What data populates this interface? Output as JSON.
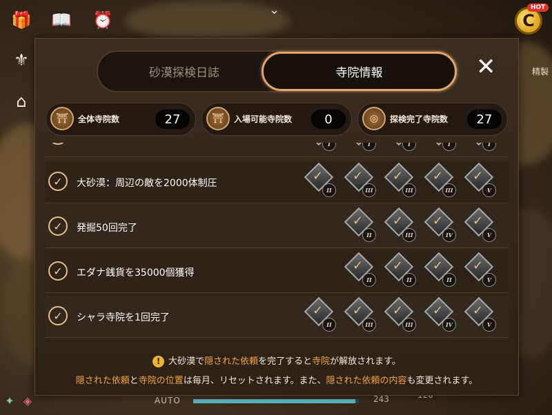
{
  "colors": {
    "accent": "#e2a56a",
    "highlight": "#f5a23a",
    "panel": "#33281d"
  },
  "tabs": [
    {
      "label": "砂漠探検日誌",
      "active": false
    },
    {
      "label": "寺院情報",
      "active": true
    }
  ],
  "stats": [
    {
      "label": "全体寺院数",
      "value": "27"
    },
    {
      "label": "入場可能寺院数",
      "value": "0"
    },
    {
      "label": "探検完了寺院数",
      "value": "27"
    }
  ],
  "rows": [
    {
      "label": "",
      "badges": [
        "I",
        "I",
        "I",
        "I",
        "I"
      ]
    },
    {
      "label": "大砂漠：周辺の敵を2000体制圧",
      "badges": [
        "II",
        "III",
        "III",
        "III",
        "V"
      ]
    },
    {
      "label": "発掘50回完了",
      "badges": [
        "II",
        "III",
        "IV",
        "V"
      ]
    },
    {
      "label": "エダナ銭貨を35000個獲得",
      "badges": [
        "II",
        "II",
        "II",
        "V"
      ]
    },
    {
      "label": "シャラ寺院を1回完了",
      "badges": [
        "II",
        "III",
        "III",
        "IV",
        "V"
      ]
    }
  ],
  "footer": {
    "line1": [
      {
        "text": "大砂漠で",
        "hl": false
      },
      {
        "text": "隠された依頼",
        "hl": true
      },
      {
        "text": "を完了すると",
        "hl": false
      },
      {
        "text": "寺院",
        "hl": true
      },
      {
        "text": "が解放されます。",
        "hl": false
      }
    ],
    "line2": [
      {
        "text": "隠された依頼",
        "hl": true
      },
      {
        "text": "と",
        "hl": false
      },
      {
        "text": "寺院の位置",
        "hl": true
      },
      {
        "text": "は毎月、リセットされます。また、",
        "hl": false
      },
      {
        "text": "隠された依頼の内容",
        "hl": true
      },
      {
        "text": "も変更されます。",
        "hl": false
      }
    ]
  },
  "hud": {
    "hot_label": "HOT",
    "coin_symbol": "C",
    "auto_label": "AUTO",
    "xp_fraction": 0.98,
    "value_a": "243",
    "value_b": "120",
    "side_label": "精製"
  }
}
